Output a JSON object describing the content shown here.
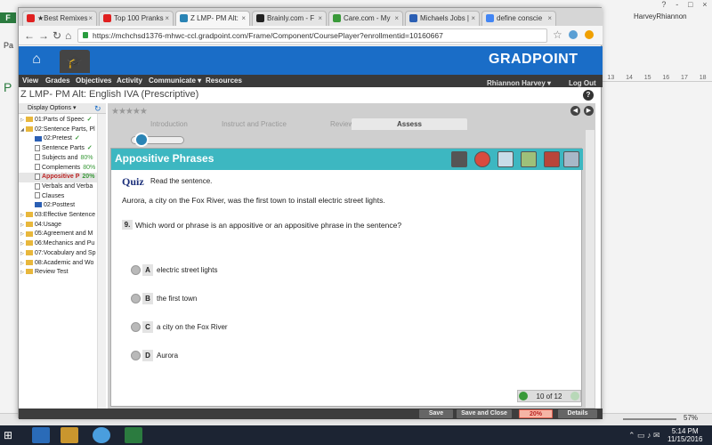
{
  "word": {
    "tab_label": "F",
    "user_name": "HarveyRhiannon",
    "window_controls": [
      "?",
      "-",
      "□",
      "×"
    ],
    "ruler": [
      "13",
      "14",
      "15",
      "16",
      "17",
      "18"
    ],
    "pa_small": "Pa",
    "pa_big": "P",
    "zoom": "57%"
  },
  "browser": {
    "tabs": [
      {
        "label": "★Best Remixes",
        "favicon_color": "#e02020"
      },
      {
        "label": "Top 100 Pranks",
        "favicon_color": "#e02020"
      },
      {
        "label": "Z LMP- PM Alt:",
        "favicon_color": "#2a84b5"
      },
      {
        "label": "Brainly.com - F",
        "favicon_color": "#222222"
      },
      {
        "label": "Care.com - My",
        "favicon_color": "#3a9a3a"
      },
      {
        "label": "Michaels Jobs |",
        "favicon_color": "#2b5fb4"
      },
      {
        "label": "define conscie",
        "favicon_color": "#4285f4"
      }
    ],
    "url": "https://mchchsd1376-mhwc-ccl.gradpoint.com/Frame/Component/CoursePlayer?enrollmentid=10160667"
  },
  "gradpoint": {
    "logo": "GRADPOINT",
    "nav": [
      "View",
      "Grades",
      "Objectives",
      "Activity",
      "Communicate ▾",
      "Resources"
    ],
    "user": "Rhiannon Harvey ▾",
    "logout": "Log Out",
    "course_title": "Z LMP- PM Alt: English IVA (Prescriptive)",
    "help": "?"
  },
  "sidebar": {
    "display_options": "Display Options ▾",
    "items": [
      {
        "label": "01:Parts of Speec",
        "icon": "folder",
        "status": "✓",
        "expanded": false,
        "indent": 0
      },
      {
        "label": "02:Sentence Parts, Pl",
        "icon": "folder",
        "status": "",
        "expanded": true,
        "indent": 0
      },
      {
        "label": "02:Pretest",
        "icon": "pretest",
        "status": "✓",
        "indent": 1
      },
      {
        "label": "Sentence Parts",
        "icon": "doc",
        "status": "✓",
        "indent": 1
      },
      {
        "label": "Subjects and",
        "icon": "doc",
        "status": "80%",
        "indent": 1
      },
      {
        "label": "Complements",
        "icon": "doc",
        "status": "80%",
        "indent": 1
      },
      {
        "label": "Appositive P",
        "icon": "doc",
        "status": "20%",
        "indent": 1,
        "selected": true
      },
      {
        "label": "Verbals and Verba",
        "icon": "doc",
        "status": "",
        "indent": 1
      },
      {
        "label": "Clauses",
        "icon": "doc",
        "status": "",
        "indent": 1
      },
      {
        "label": "02:Posttest",
        "icon": "pretest",
        "status": "",
        "indent": 1
      },
      {
        "label": "03:Effective Sentence",
        "icon": "folder",
        "status": "",
        "expanded": false,
        "indent": 0
      },
      {
        "label": "04:Usage",
        "icon": "folder",
        "status": "",
        "expanded": false,
        "indent": 0
      },
      {
        "label": "05:Agreement and M",
        "icon": "folder",
        "status": "",
        "expanded": false,
        "indent": 0
      },
      {
        "label": "06:Mechanics and Pu",
        "icon": "folder",
        "status": "",
        "expanded": false,
        "indent": 0
      },
      {
        "label": "07:Vocabulary and Sp",
        "icon": "folder",
        "status": "",
        "expanded": false,
        "indent": 0
      },
      {
        "label": "08:Academic and Wo",
        "icon": "folder",
        "status": "",
        "expanded": false,
        "indent": 0
      },
      {
        "label": "Review Test",
        "icon": "folder",
        "status": "",
        "expanded": false,
        "indent": 0
      }
    ]
  },
  "content": {
    "stars": "★★★★★",
    "phase_tabs": [
      "Introduction",
      "Instruct and Practice",
      "Review",
      "Assess"
    ],
    "active_tab": "Assess",
    "panel_title": "Appositive Phrases",
    "quiz_label": "Quiz",
    "quiz_instruction": "Read the sentence.",
    "passage": "Aurora, a city on the Fox River, was the first town to install electric street lights.",
    "question_number": "9.",
    "question": "Which word or phrase is an appositive or an appositive phrase in the sentence?",
    "options": [
      {
        "letter": "A",
        "text": "electric street lights"
      },
      {
        "letter": "B",
        "text": "the first town"
      },
      {
        "letter": "C",
        "text": "a city on the Fox River"
      },
      {
        "letter": "D",
        "text": "Aurora"
      }
    ],
    "pager": "10 of 12"
  },
  "bottom": {
    "save": "Save",
    "save_close": "Save and Close",
    "percent": "20%",
    "details": "Details"
  },
  "taskbar": {
    "time": "5:14 PM",
    "date": "11/15/2016"
  }
}
